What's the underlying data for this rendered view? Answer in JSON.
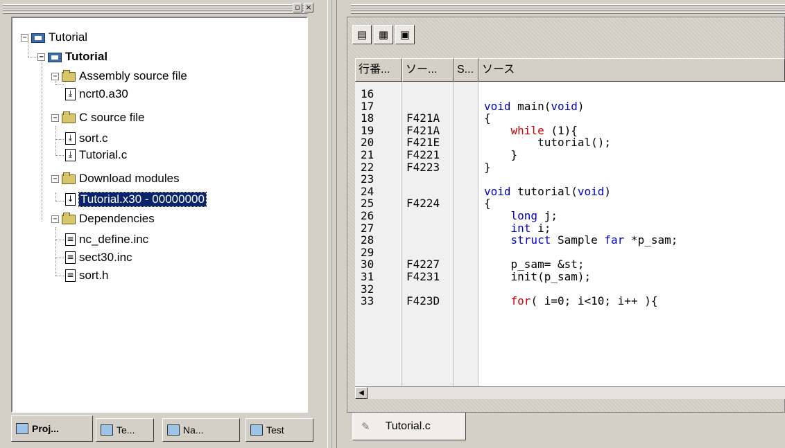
{
  "project_tree": {
    "workspace": "Tutorial",
    "project": "Tutorial",
    "folders": [
      {
        "label": "Assembly source file",
        "files": [
          "ncrt0.a30"
        ]
      },
      {
        "label": "C source file",
        "files": [
          "sort.c",
          "Tutorial.c"
        ]
      },
      {
        "label": "Download modules",
        "files": [
          "Tutorial.x30 - 00000000"
        ]
      },
      {
        "label": "Dependencies",
        "files": [
          "nc_define.inc",
          "sect30.inc",
          "sort.h"
        ]
      }
    ],
    "selected_item": "Tutorial.x30 - 00000000"
  },
  "left_tabs": [
    "Proj...",
    "Te...",
    "Na...",
    "Test"
  ],
  "left_active_tab": "Proj...",
  "editor": {
    "columns": [
      "行番...",
      "ソー...",
      "S...",
      "ソース"
    ],
    "lines": [
      {
        "ln": "16",
        "addr": "",
        "src": ""
      },
      {
        "ln": "17",
        "addr": "",
        "src": "void main(void)"
      },
      {
        "ln": "18",
        "addr": "F421A",
        "src": "{"
      },
      {
        "ln": "19",
        "addr": "F421A",
        "src": "    while (1){"
      },
      {
        "ln": "20",
        "addr": "F421E",
        "src": "        tutorial();"
      },
      {
        "ln": "21",
        "addr": "F4221",
        "src": "    }"
      },
      {
        "ln": "22",
        "addr": "F4223",
        "src": "}"
      },
      {
        "ln": "23",
        "addr": "",
        "src": ""
      },
      {
        "ln": "24",
        "addr": "",
        "src": "void tutorial(void)"
      },
      {
        "ln": "25",
        "addr": "F4224",
        "src": "{"
      },
      {
        "ln": "26",
        "addr": "",
        "src": "    long j;"
      },
      {
        "ln": "27",
        "addr": "",
        "src": "    int i;"
      },
      {
        "ln": "28",
        "addr": "",
        "src": "    struct Sample far *p_sam;"
      },
      {
        "ln": "29",
        "addr": "",
        "src": ""
      },
      {
        "ln": "30",
        "addr": "F4227",
        "src": "    p_sam= &st;"
      },
      {
        "ln": "31",
        "addr": "F4231",
        "src": "    init(p_sam);"
      },
      {
        "ln": "32",
        "addr": "",
        "src": ""
      },
      {
        "ln": "33",
        "addr": "F423D",
        "src": "    for( i=0; i<10; i++ ){"
      }
    ],
    "file_tab": "Tutorial.c"
  },
  "icons": {
    "workspace": "workspace-icon",
    "project": "project-icon",
    "folder": "folder-icon",
    "file": "source-file-icon",
    "download": "download-module-icon",
    "toolbar": [
      "source-mode-icon",
      "disassembly-mode-icon",
      "mixed-mode-icon"
    ]
  },
  "colors": {
    "selection": "#0a246a",
    "keyword_blue": "#0000c0",
    "keyword_red": "#d00000"
  }
}
